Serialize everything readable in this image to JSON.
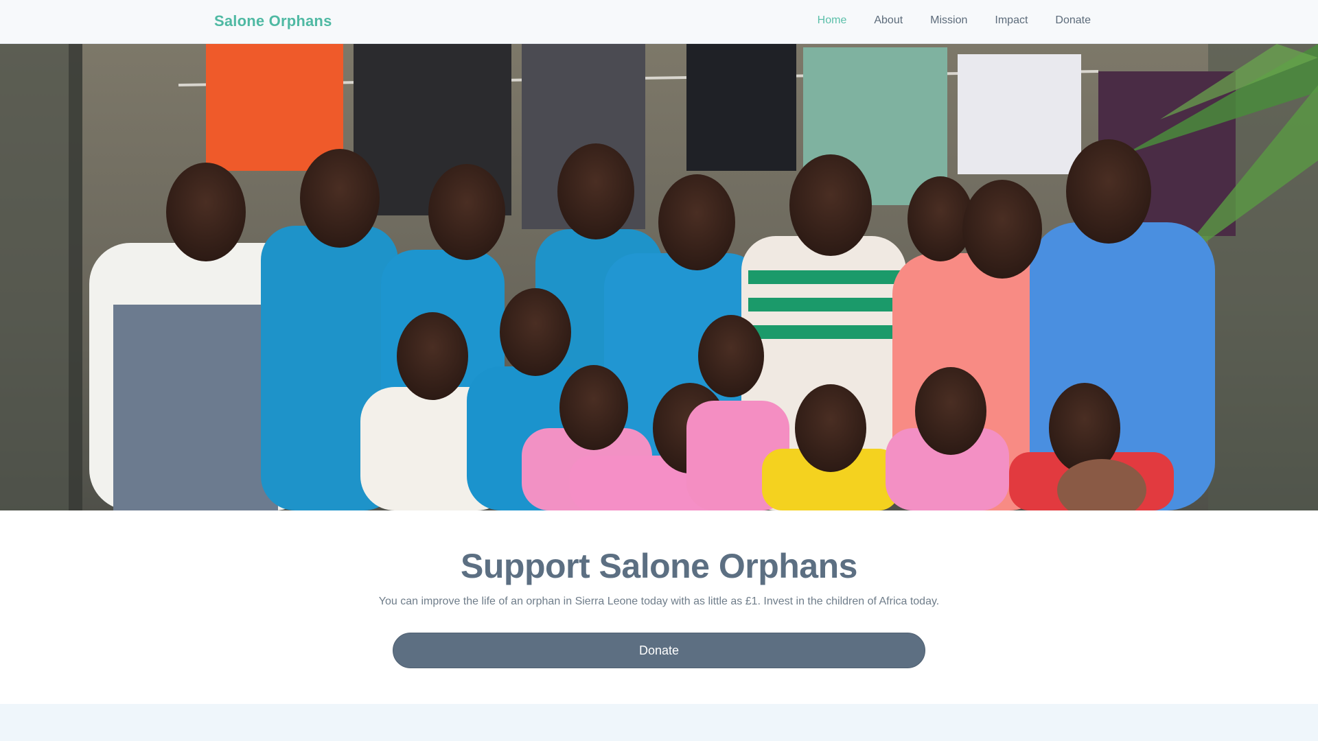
{
  "header": {
    "brand": "Salone Orphans",
    "nav": [
      {
        "label": "Home",
        "active": true
      },
      {
        "label": "About",
        "active": false
      },
      {
        "label": "Mission",
        "active": false
      },
      {
        "label": "Impact",
        "active": false
      },
      {
        "label": "Donate",
        "active": false
      }
    ]
  },
  "hero": {
    "image": "group-photo-of-children"
  },
  "cta": {
    "title": "Support Salone Orphans",
    "text": "You can improve the life of an orphan in Sierra Leone today with as little as £1. Invest in the children of Africa today.",
    "button_label": "Donate"
  },
  "colors": {
    "brand": "#4fb9a3",
    "nav_active": "#5bbfa9",
    "nav_text": "#5c6b7a",
    "title": "#5c6f82",
    "button": "#5d6f82",
    "next_section_bg": "#eff6fb"
  }
}
